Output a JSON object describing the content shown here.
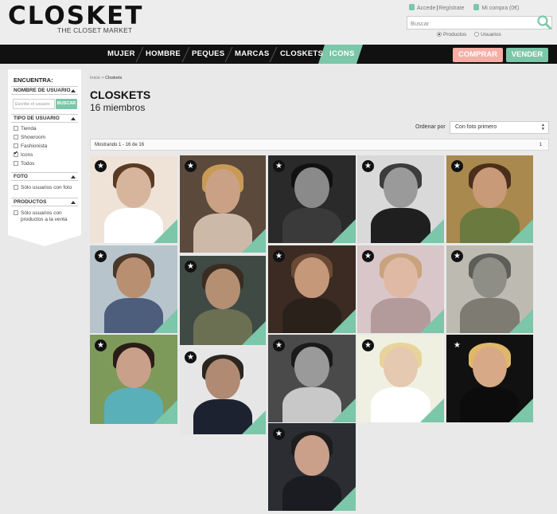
{
  "header": {
    "logo": "CLOSKET",
    "tagline": "THE CLOSET MARKET",
    "login_link": "Accede",
    "register_link": "Regístrate",
    "cart_label": "Mi compra (0€)",
    "search_placeholder": "Buscar",
    "search_options": [
      "Productos",
      "Usuarios"
    ]
  },
  "nav": {
    "items": [
      "MUJER",
      "HOMBRE",
      "PEQUES",
      "MARCAS",
      "CLOSKETS",
      "ICONS"
    ],
    "active": "ICONS",
    "buy_label": "COMPRAR",
    "sell_label": "VENDER"
  },
  "sidebar": {
    "title": "ENCUENTRA:",
    "username_section": "NOMBRE DE USUARIO",
    "username_placeholder": "Escribe el usuario",
    "search_button": "BUSCAR",
    "user_type_section": "TIPO DE USUARIO",
    "user_types": [
      "Tienda",
      "Showroom",
      "Fashionista",
      "Icons",
      "Todos"
    ],
    "user_type_checked": "Icons",
    "photo_section": "FOTO",
    "photo_option": "Sólo usuarios con foto",
    "products_section": "PRODUCTOS",
    "products_option_line1": "Sólo usuarios con",
    "products_option_line2": "productos a la venta"
  },
  "main": {
    "breadcrumb_home": "Inicio",
    "breadcrumb_sep": ">",
    "breadcrumb_current": "Closkets",
    "title": "CLOSKETS",
    "member_count": "16 miembros",
    "sort_label": "Ordenar por",
    "sort_value": "Con foto primero",
    "showing_text": "Mostrando 1 - 16 de 16",
    "page_number": "1",
    "star_glyph": "★"
  },
  "colors": {
    "accent": "#7cc6a9",
    "buy": "#f6aea5",
    "nav_bg": "#111111"
  }
}
